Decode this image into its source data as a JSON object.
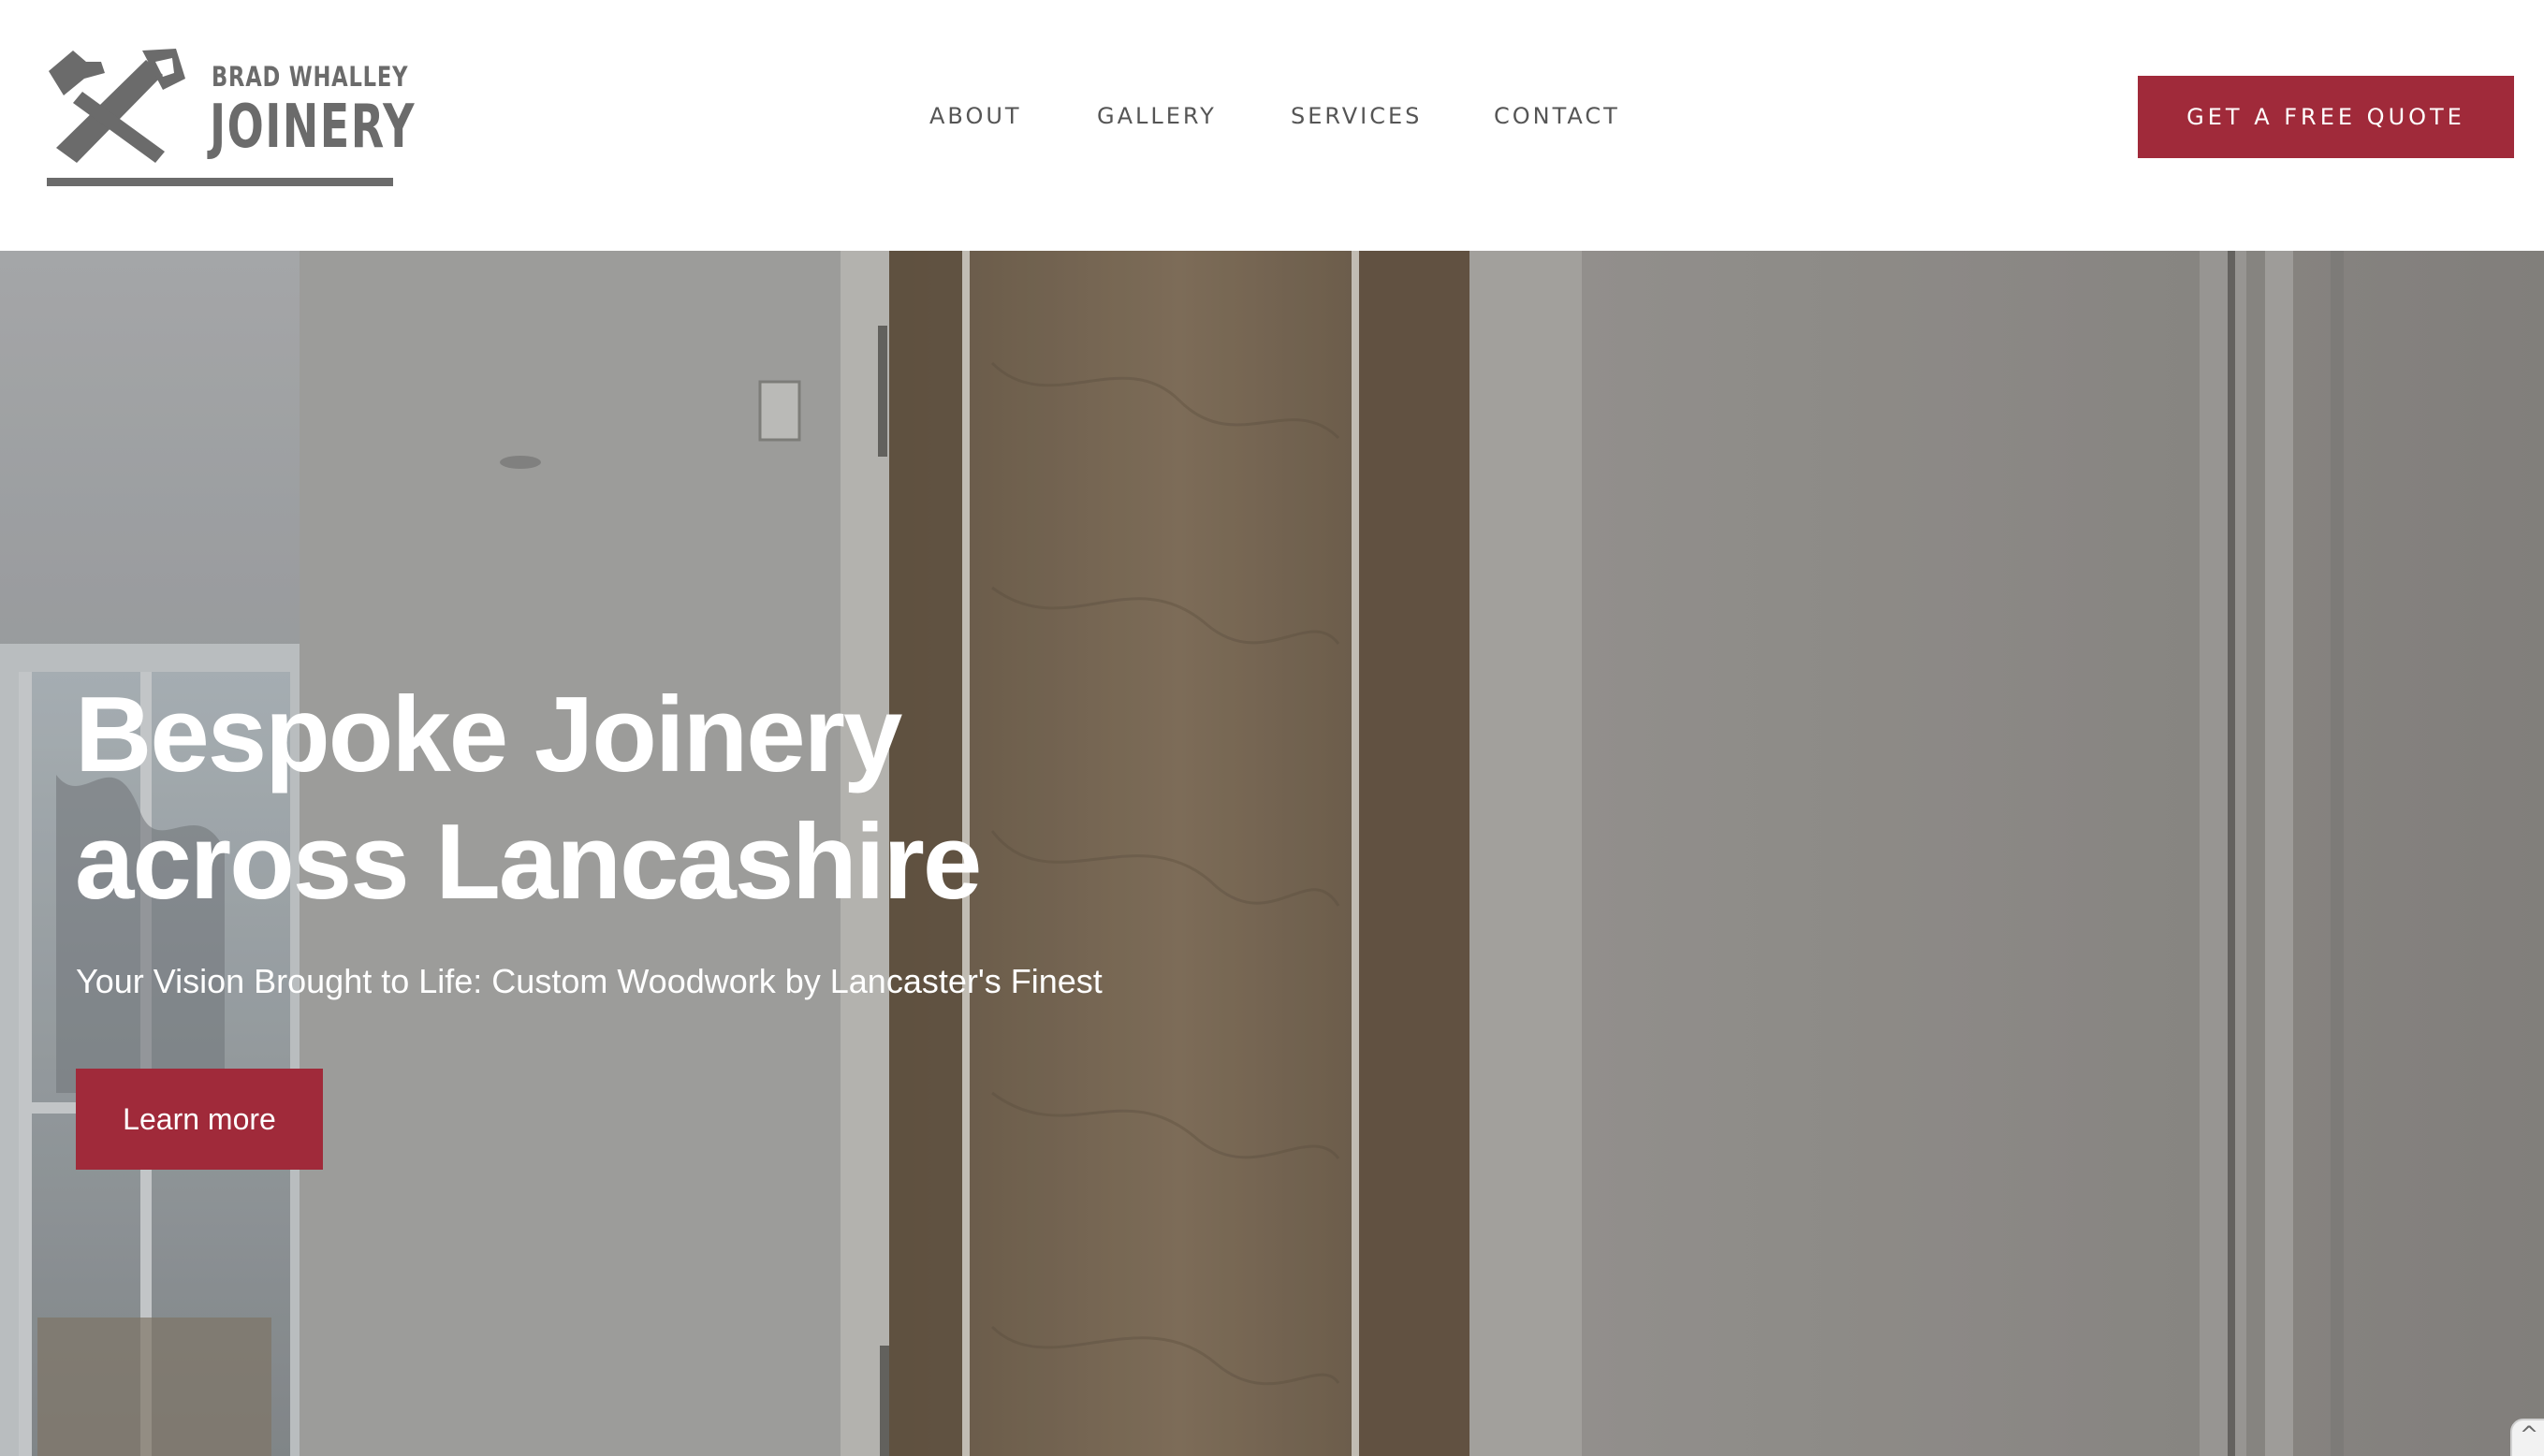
{
  "brand": {
    "name_small": "BRAD WHALLEY",
    "name_big": "JOINERY",
    "logo_icon": "hammer-and-saw-icon",
    "color": "#6b6b6b"
  },
  "nav": {
    "items": [
      {
        "label": "ABOUT"
      },
      {
        "label": "GALLERY"
      },
      {
        "label": "SERVICES"
      },
      {
        "label": "CONTACT"
      }
    ]
  },
  "header": {
    "cta_label": "GET A FREE QUOTE"
  },
  "hero": {
    "title_line1": "Bespoke Joinery",
    "title_line2": "across Lancashire",
    "subtitle": "Your Vision Brought to Life: Custom Woodwork by Lancaster's Finest",
    "button_label": "Learn more",
    "background": "interior-door-photo"
  },
  "back_to_top": {
    "icon": "chevron-up-icon",
    "glyph": "^"
  },
  "colors": {
    "accent": "#a02a3a",
    "nav_text": "#555555",
    "header_bg": "#ffffff"
  }
}
